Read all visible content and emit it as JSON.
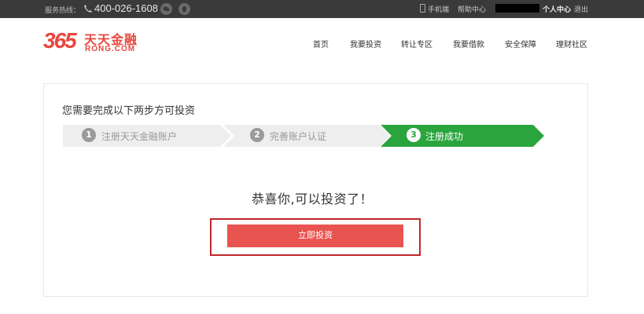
{
  "topbar": {
    "hotline_label": "服务热线：",
    "phone_number": "400-026-1608",
    "mobile_label": "手机端",
    "help_label": "帮助中心",
    "user_center_label": "个人中心",
    "logout_label": "退出"
  },
  "logo": {
    "number": "365",
    "name_cn": "天天金融",
    "name_en": "RONG.COM"
  },
  "nav": [
    "首页",
    "我要投资",
    "转让专区",
    "我要借款",
    "安全保障",
    "理财社区"
  ],
  "card": {
    "title": "您需要完成以下两步方可投资",
    "steps": [
      {
        "number": "1",
        "label": "注册天天金融账户",
        "active": false
      },
      {
        "number": "2",
        "label": "完善账户认证",
        "active": false
      },
      {
        "number": "3",
        "label": "注册成功",
        "active": true
      }
    ],
    "congrats": "恭喜你,可以投资了！",
    "invest_button": "立即投资"
  },
  "colors": {
    "brand_red": "#e8473f",
    "button_red": "#e85450",
    "highlight_border": "#c0262a",
    "step_active": "#2aa53d",
    "step_inactive": "#eeeeee",
    "topbar_bg": "#3a3a3a"
  }
}
